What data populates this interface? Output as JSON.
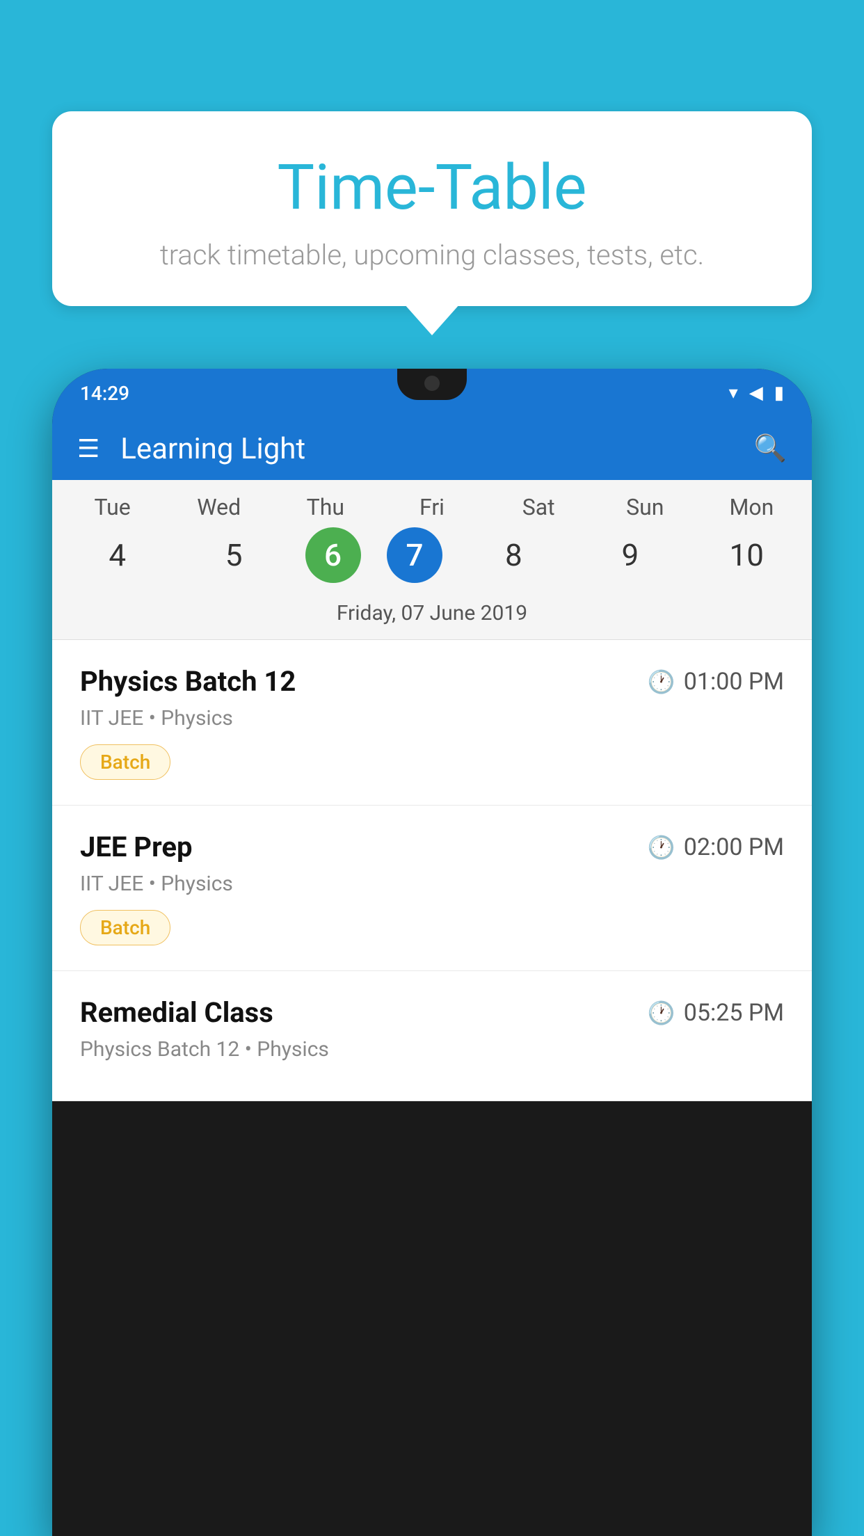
{
  "background_color": "#29b6d8",
  "tooltip": {
    "title": "Time-Table",
    "subtitle": "track timetable, upcoming classes, tests, etc."
  },
  "phone": {
    "status_bar": {
      "time": "14:29"
    },
    "app_header": {
      "title": "Learning Light"
    },
    "calendar": {
      "days": [
        {
          "label": "Tue",
          "number": "4"
        },
        {
          "label": "Wed",
          "number": "5"
        },
        {
          "label": "Thu",
          "number": "6",
          "state": "today"
        },
        {
          "label": "Fri",
          "number": "7",
          "state": "selected"
        },
        {
          "label": "Sat",
          "number": "8"
        },
        {
          "label": "Sun",
          "number": "9"
        },
        {
          "label": "Mon",
          "number": "10"
        }
      ],
      "selected_date_label": "Friday, 07 June 2019"
    },
    "classes": [
      {
        "name": "Physics Batch 12",
        "time": "01:00 PM",
        "meta": "IIT JEE • Physics",
        "badge": "Batch"
      },
      {
        "name": "JEE Prep",
        "time": "02:00 PM",
        "meta": "IIT JEE • Physics",
        "badge": "Batch"
      },
      {
        "name": "Remedial Class",
        "time": "05:25 PM",
        "meta": "Physics Batch 12 • Physics",
        "badge": null
      }
    ]
  }
}
